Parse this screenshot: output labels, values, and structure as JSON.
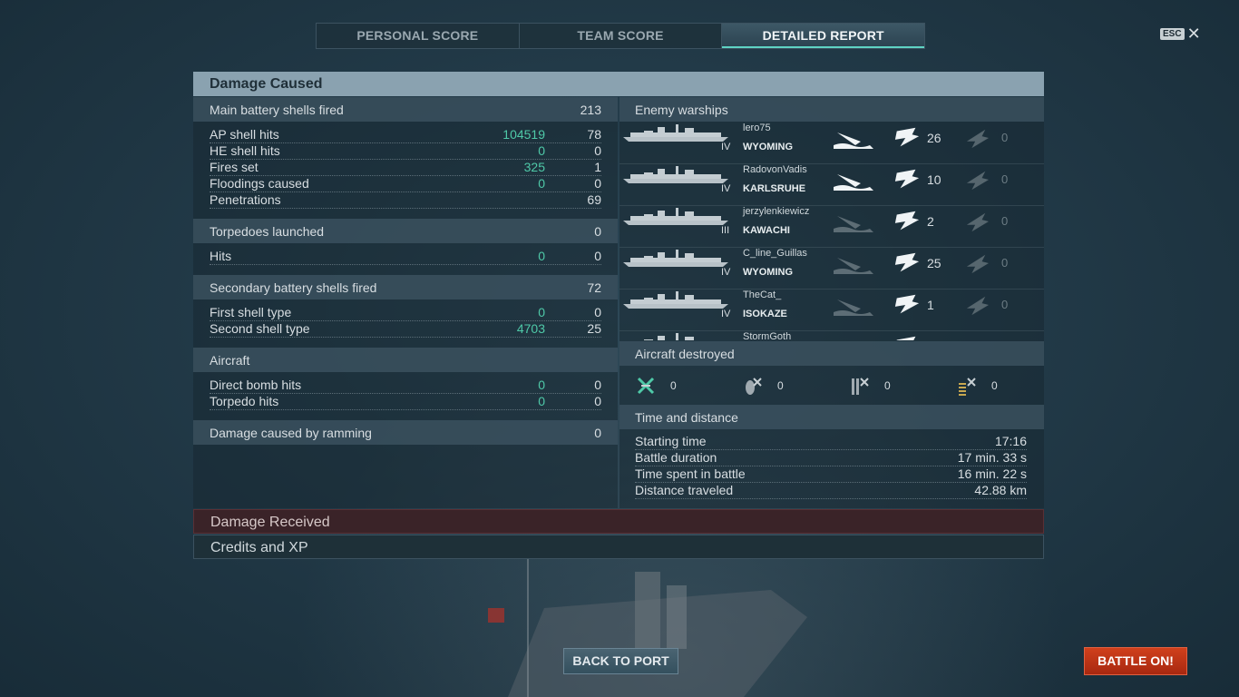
{
  "tabs": [
    {
      "label": "PERSONAL SCORE",
      "active": false
    },
    {
      "label": "TEAM SCORE",
      "active": false
    },
    {
      "label": "DETAILED REPORT",
      "active": true
    }
  ],
  "esc": {
    "key": "ESC",
    "close_glyph": "✕"
  },
  "damage_caused": {
    "title": "Damage Caused",
    "main_battery": {
      "label": "Main battery shells fired",
      "value": "213",
      "rows": [
        {
          "label": "AP shell hits",
          "hits": "104519",
          "value": "78"
        },
        {
          "label": "HE shell hits",
          "hits": "0",
          "value": "0"
        },
        {
          "label": "Fires set",
          "hits": "325",
          "value": "1"
        },
        {
          "label": "Floodings caused",
          "hits": "0",
          "value": "0"
        },
        {
          "label": "Penetrations",
          "hits": "",
          "value": "69"
        }
      ]
    },
    "torpedoes": {
      "label": "Torpedoes launched",
      "value": "0",
      "rows": [
        {
          "label": "Hits",
          "hits": "0",
          "value": "0"
        }
      ]
    },
    "secondary": {
      "label": "Secondary battery shells fired",
      "value": "72",
      "rows": [
        {
          "label": "First shell type",
          "hits": "0",
          "value": "0"
        },
        {
          "label": "Second shell type",
          "hits": "4703",
          "value": "25"
        }
      ]
    },
    "aircraft": {
      "label": "Aircraft",
      "rows": [
        {
          "label": "Direct bomb hits",
          "hits": "0",
          "value": "0"
        },
        {
          "label": "Torpedo hits",
          "hits": "0",
          "value": "0"
        }
      ]
    },
    "ramming": {
      "label": "Damage caused by ramming",
      "value": "0"
    }
  },
  "enemy_warships": {
    "label": "Enemy warships",
    "ships": [
      {
        "player": "lero75",
        "tier": "IV",
        "ship": "WYOMING",
        "sunk": true,
        "hits": "26",
        "other": "0"
      },
      {
        "player": "RadovonVadis",
        "tier": "IV",
        "ship": "KARLSRUHE",
        "sunk": true,
        "hits": "10",
        "other": "0"
      },
      {
        "player": "jerzylenkiewicz",
        "tier": "III",
        "ship": "KAWACHI",
        "sunk": false,
        "hits": "2",
        "other": "0"
      },
      {
        "player": "C_line_Guillas",
        "tier": "IV",
        "ship": "WYOMING",
        "sunk": false,
        "hits": "25",
        "other": "0"
      },
      {
        "player": "TheCat_",
        "tier": "IV",
        "ship": "ISOKAZE",
        "sunk": false,
        "hits": "1",
        "other": "0"
      },
      {
        "player": "StormGoth",
        "tier": "",
        "ship": "",
        "sunk": true,
        "hits": "",
        "other": ""
      }
    ]
  },
  "aircraft_destroyed": {
    "label": "Aircraft destroyed",
    "items": [
      {
        "icon": "fighter-icon",
        "value": "0"
      },
      {
        "icon": "bomber-icon",
        "value": "0"
      },
      {
        "icon": "torpedo-bomber-icon",
        "value": "0"
      },
      {
        "icon": "spotter-icon",
        "value": "0"
      }
    ]
  },
  "time_distance": {
    "label": "Time and distance",
    "rows": [
      {
        "label": "Starting time",
        "value": "17:16"
      },
      {
        "label": "Battle duration",
        "value": "17 min. 33 s"
      },
      {
        "label": "Time spent in battle",
        "value": "16 min. 22 s"
      },
      {
        "label": "Distance traveled",
        "value": "42.88 km"
      }
    ]
  },
  "damage_received": {
    "label": "Damage Received"
  },
  "credits_xp": {
    "label": "Credits and XP"
  },
  "buttons": {
    "back": "BACK TO PORT",
    "battle": "BATTLE ON!"
  },
  "colors": {
    "hits": "#4fc9a8",
    "battle_button": "#c0361a",
    "damage_header": "#8aa2b0"
  }
}
